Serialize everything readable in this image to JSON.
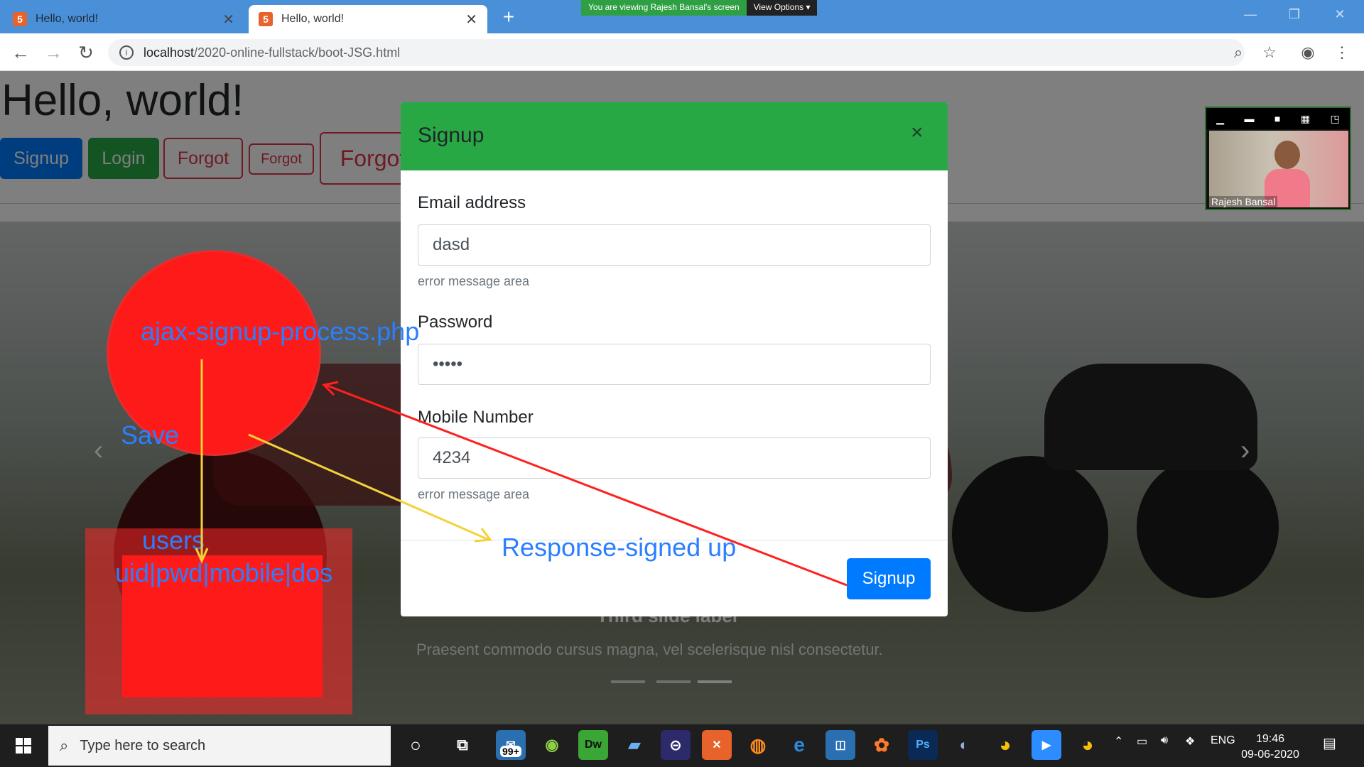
{
  "browser": {
    "tabs": [
      {
        "title": "Hello, world!",
        "active": false
      },
      {
        "title": "Hello, world!",
        "active": true
      }
    ],
    "share_banner": {
      "message": "You are viewing Rajesh Bansal's screen",
      "options_label": "View Options"
    },
    "url": {
      "host": "localhost",
      "path": "/2020-online-fullstack/boot-JSG.html"
    }
  },
  "page": {
    "heading": "Hello, world!",
    "buttons": {
      "signup": "Signup",
      "login": "Login",
      "forgot_lg": "Forgot",
      "forgot_sm": "Forgot",
      "forgot_xl": "Forgot"
    },
    "carousel": {
      "label": "Third slide label",
      "caption": "Praesent commodo cursus magna, vel scelerisque nisl consectetur."
    }
  },
  "modal": {
    "title": "Signup",
    "close_glyph": "×",
    "email_label": "Email address",
    "email_value": "dasd",
    "email_help": "error message area",
    "password_label": "Password",
    "password_value": "•••••",
    "mobile_label": "Mobile Number",
    "mobile_value": "4234",
    "mobile_help": "error message area",
    "submit": "Signup"
  },
  "annotations": {
    "circle_text": "ajax-signup-process.php",
    "save": "Save",
    "users": "users",
    "columns": "uid|pwd|mobile|dos",
    "response": "Response-signed up",
    "colors": {
      "red": "#ff1a1a",
      "arrow_yellow": "#f2d23a",
      "arrow_red": "#ff2020",
      "text_blue": "#2a7fff"
    }
  },
  "video": {
    "name": "Rajesh Bansal"
  },
  "taskbar": {
    "search_placeholder": "Type here to search",
    "badge": "99+",
    "language": "ENG",
    "time": "19:46",
    "date": "09-06-2020"
  },
  "colors": {
    "primary": "#007bff",
    "success": "#28a745",
    "danger": "#dc3545",
    "chrome_blue": "#4a90d9"
  }
}
